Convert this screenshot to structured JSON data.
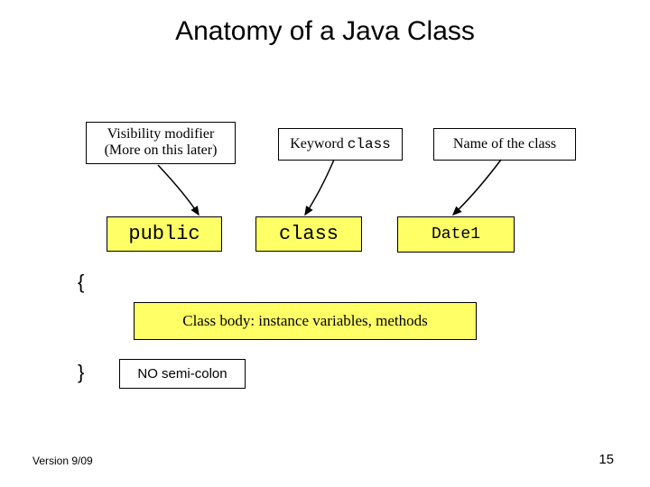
{
  "title": "Anatomy of a Java Class",
  "labels": {
    "visibility_l1": "Visibility modifier",
    "visibility_l2": "(More on this later)",
    "keyword_prefix": "Keyword ",
    "keyword_mono": "class",
    "name": "Name of the class"
  },
  "code": {
    "public": "public",
    "class": "class",
    "classname": "Date1",
    "open_brace": "{",
    "close_brace": "}"
  },
  "class_body": "Class body: instance variables, methods",
  "no_semicolon": "NO semi-colon",
  "footer": {
    "version": "Version 9/09",
    "page": "15"
  }
}
